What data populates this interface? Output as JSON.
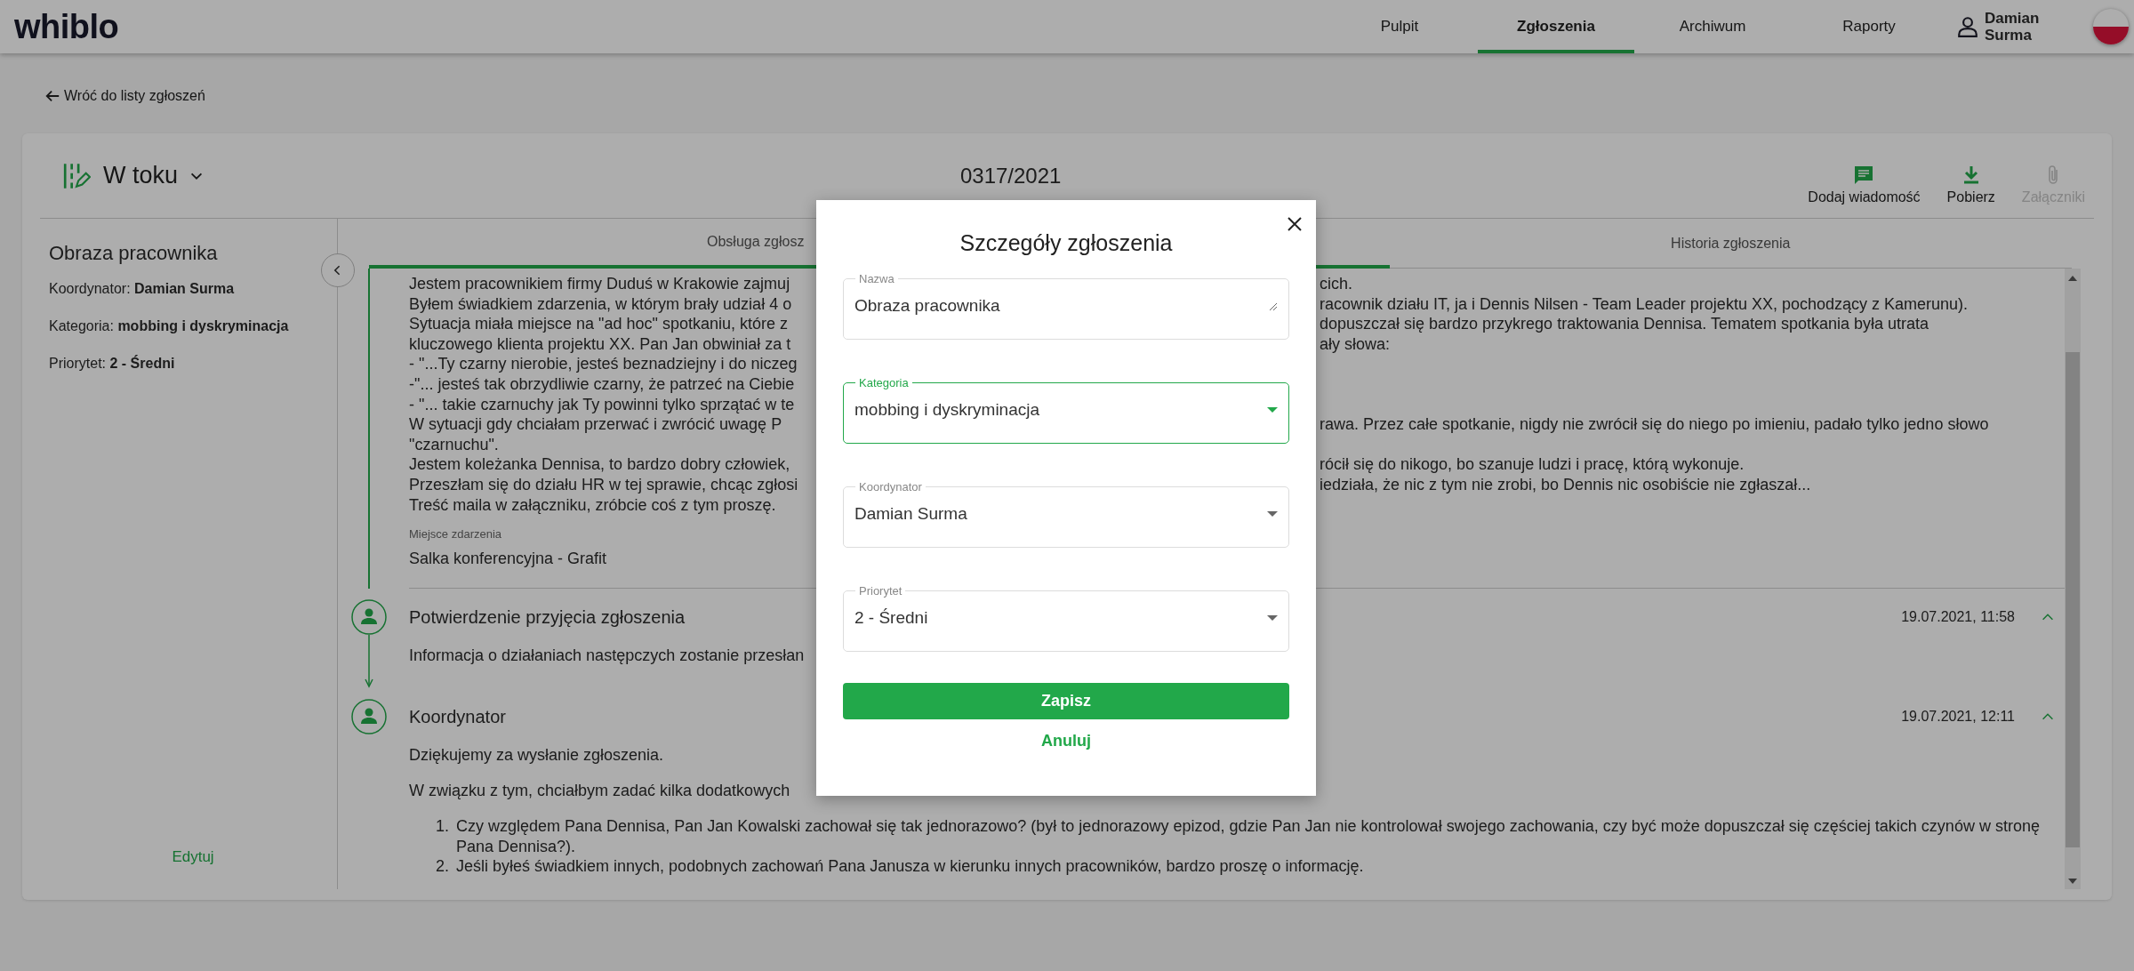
{
  "header": {
    "logo": "whiblo",
    "nav": [
      {
        "label": "Pulpit",
        "selected": false
      },
      {
        "label": "Zgłoszenia",
        "selected": true
      },
      {
        "label": "Archiwum",
        "selected": false
      },
      {
        "label": "Raporty",
        "selected": false
      }
    ],
    "user": "Damian Surma"
  },
  "back_link": "Wróć do listy zgłoszeń",
  "case": {
    "status": "W toku",
    "number": "0317/2021",
    "actions": [
      {
        "kind": "message",
        "label": "Dodaj wiadomość",
        "disabled": false
      },
      {
        "kind": "download",
        "label": "Pobierz",
        "disabled": false
      },
      {
        "kind": "attachment",
        "label": "Załączniki",
        "disabled": true
      }
    ]
  },
  "sidebar": {
    "title": "Obraza pracownika",
    "fields": [
      "Koordynator: **Damian Surma**",
      "Kategoria: **mobbing i dyskryminacja**",
      "Priorytet: **2 - Średni**"
    ],
    "edit": "Edytuj"
  },
  "tabs": [
    {
      "label": "Obsługa zgłosz",
      "selected": true
    },
    {
      "label": "Historia zgłoszenia",
      "selected": false
    }
  ],
  "report": {
    "lines": [
      {
        "left": "Jestem pracownikiem firmy Duduś w Krakowie zajmuj",
        "right": "cich."
      },
      {
        "left": "Byłem świadkiem zdarzenia, w którym brały udział 4 o",
        "right": "racownik działu IT, ja i Dennis Nilsen - Team Leader projektu XX, pochodzący z Kamerunu)."
      },
      {
        "left": "Sytuacja miała miejsce na \"ad hoc\" spotkaniu, które z",
        "right": "dopuszczał się bardzo przykrego traktowania Dennisa. Tematem spotkania była utrata"
      },
      {
        "left": "kluczowego klienta projektu XX. Pan Jan obwiniał za t",
        "right": "ały słowa:"
      },
      {
        "left": "- \"...Ty czarny nierobie, jesteś beznadziejny i do niczeg"
      },
      {
        "left": "-\"... jesteś tak obrzydliwie czarny, że patrzeć na Ciebie"
      },
      {
        "left": "- \"... takie czarnuchy jak Ty powinni tylko sprzątać w te"
      },
      {
        "left": "W sytuacji gdy chciałam przerwać i zwrócić uwagę P",
        "right": "rawa. Przez całe spotkanie, nigdy nie zwrócił się do niego po imieniu, padało tylko jedno słowo"
      },
      {
        "left": "\"czarnuchu\"."
      },
      {
        "left": "Jestem koleżanka Dennisa, to bardzo dobry człowiek,",
        "right": "rócił się do nikogo, bo szanuje ludzi i pracę, którą wykonuje."
      },
      {
        "left": "Przeszłam się do działu HR w tej sprawie, chcąc zgłosi",
        "right": "iedziała, że nic z tym nie zrobi, bo Dennis nic osobiście nie zgłaszał..."
      },
      {
        "left": "Treść maila w załączniku, zróbcie coś z tym proszę."
      }
    ],
    "place_label": "Miejsce zdarzenia",
    "place": "Salka konferencyjna - Grafit"
  },
  "entries": [
    {
      "title": "Potwierdzenie przyjęcia zgłoszenia",
      "date": "19.07.2021, 11:58",
      "expanded": true,
      "paragraphs": [
        "Informacja o działaniach następczych zostanie przesłan"
      ]
    },
    {
      "title": "Koordynator",
      "date": "19.07.2021, 12:11",
      "expanded": true,
      "paragraphs": [
        "Dziękujemy za wysłanie zgłoszenia.",
        "W związku z tym, chciałbym zadać kilka dodatkowych"
      ],
      "list": [
        {
          "number": "1.",
          "text": "Czy względem Pana Dennisa, Pan Jan Kowalski zachował się tak jednorazowo? (był to jednorazowy epizod, gdzie Pan Jan nie kontrolował swojego zachowania, czy być może dopuszczał się częściej takich czynów w stronę Pana Dennisa?)."
        },
        {
          "number": "2.",
          "text": "Jeśli byłeś świadkiem innych, podobnych zachowań Pana Janusza w kierunku innych pracowników, bardzo proszę o informację."
        }
      ]
    }
  ],
  "modal": {
    "title": "Szczegóły zgłoszenia",
    "fields": [
      {
        "kind": "textarea",
        "label": "Nazwa",
        "value": "Obraza pracownika",
        "focused": false
      },
      {
        "kind": "select",
        "label": "Kategoria",
        "value": "mobbing i dyskryminacja",
        "focused": true
      },
      {
        "kind": "select",
        "label": "Koordynator",
        "value": "Damian Surma",
        "focused": false
      },
      {
        "kind": "select",
        "label": "Priorytet",
        "value": "2 - Średni",
        "focused": false
      }
    ],
    "save": "Zapisz",
    "cancel": "Anuluj"
  }
}
